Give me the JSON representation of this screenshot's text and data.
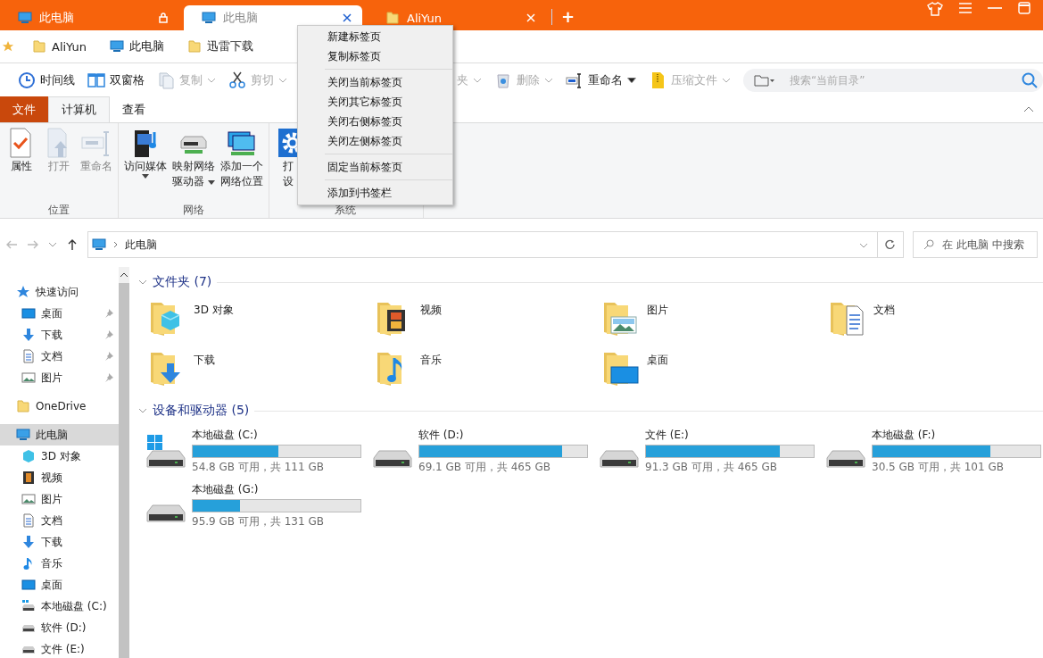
{
  "tabs": [
    {
      "label": "此电脑",
      "selected": false,
      "locked": true,
      "kind": "pc"
    },
    {
      "label": "此电脑",
      "selected": true,
      "locked": false,
      "kind": "pc"
    },
    {
      "label": "AliYun",
      "selected": false,
      "locked": false,
      "kind": "folder"
    }
  ],
  "new_tab": "+",
  "bookmarks": [
    {
      "label": "AliYun",
      "kind": "folder"
    },
    {
      "label": "此电脑",
      "kind": "pc"
    },
    {
      "label": "迅雷下载",
      "kind": "folder"
    }
  ],
  "toolbar": [
    {
      "label": "时间线",
      "kind": "clock",
      "disabled": false,
      "dropdown": false
    },
    {
      "label": "双窗格",
      "kind": "panes",
      "disabled": false,
      "dropdown": false
    },
    {
      "label": "复制",
      "kind": "copy",
      "disabled": true,
      "dropdown": true
    },
    {
      "label": "剪切",
      "kind": "scissors",
      "disabled": true,
      "dropdown": true
    },
    {
      "label": "夹",
      "kind": "text",
      "disabled": true,
      "dropdown": true
    },
    {
      "label": "删除",
      "kind": "trash",
      "disabled": true,
      "dropdown": true
    },
    {
      "label": "重命名",
      "kind": "rename",
      "disabled": false,
      "dropdown": true
    },
    {
      "label": "压缩文件",
      "kind": "zip",
      "disabled": true,
      "dropdown": true
    }
  ],
  "toolbar_search": {
    "placeholder": "搜索“当前目录”"
  },
  "ribbon_tabs": [
    {
      "label": "文件",
      "kind": "file",
      "selected": false
    },
    {
      "label": "计算机",
      "kind": "tab",
      "selected": true
    },
    {
      "label": "查看",
      "kind": "tab",
      "selected": false
    }
  ],
  "ribbon_groups": [
    {
      "label": "位置",
      "buttons": [
        {
          "lines": [
            "属性"
          ],
          "kind": "properties",
          "disabled": false,
          "dropdown": false
        },
        {
          "lines": [
            "打开"
          ],
          "kind": "open",
          "disabled": true,
          "dropdown": false
        },
        {
          "lines": [
            "重命名"
          ],
          "kind": "rename",
          "disabled": true,
          "dropdown": false
        }
      ]
    },
    {
      "label": "网络",
      "buttons": [
        {
          "lines": [
            "访问媒体"
          ],
          "kind": "media",
          "disabled": false,
          "dropdown": true
        },
        {
          "lines": [
            "映射网络",
            "驱动器"
          ],
          "kind": "netdrive",
          "disabled": false,
          "dropdown": true
        },
        {
          "lines": [
            "添加一个",
            "网络位置"
          ],
          "kind": "netloc",
          "disabled": false,
          "dropdown": false
        }
      ]
    },
    {
      "label": "系统",
      "buttons": [
        {
          "lines": [
            "打",
            "设"
          ],
          "kind": "settings",
          "disabled": false,
          "dropdown": false
        }
      ]
    }
  ],
  "context_menu": [
    {
      "label": "新建标签页",
      "kind": "item"
    },
    {
      "label": "复制标签页",
      "kind": "item"
    },
    {
      "kind": "separator"
    },
    {
      "label": "关闭当前标签页",
      "kind": "item"
    },
    {
      "label": "关闭其它标签页",
      "kind": "item"
    },
    {
      "label": "关闭右侧标签页",
      "kind": "item"
    },
    {
      "label": "关闭左侧标签页",
      "kind": "item"
    },
    {
      "kind": "separator"
    },
    {
      "label": "固定当前标签页",
      "kind": "item"
    },
    {
      "kind": "separator"
    },
    {
      "label": "添加到书签栏",
      "kind": "item"
    }
  ],
  "address": {
    "path": "此电脑",
    "search_placeholder": "在 此电脑 中搜索"
  },
  "sidebar": [
    {
      "label": "快速访问",
      "kind": "star",
      "selected": false,
      "pinned": false,
      "children": [
        {
          "label": "桌面",
          "kind": "desktop",
          "selected": false,
          "pinned": true
        },
        {
          "label": "下载",
          "kind": "downloads",
          "selected": false,
          "pinned": true
        },
        {
          "label": "文档",
          "kind": "documents",
          "selected": false,
          "pinned": true
        },
        {
          "label": "图片",
          "kind": "pictures",
          "selected": false,
          "pinned": true
        }
      ]
    },
    {
      "label": "OneDrive",
      "kind": "folder",
      "selected": false,
      "pinned": false
    },
    {
      "label": "此电脑",
      "kind": "pc",
      "selected": true,
      "pinned": false,
      "children": [
        {
          "label": "3D 对象",
          "kind": "objects",
          "selected": false,
          "pinned": false
        },
        {
          "label": "视频",
          "kind": "video",
          "selected": false,
          "pinned": false
        },
        {
          "label": "图片",
          "kind": "pictures",
          "selected": false,
          "pinned": false
        },
        {
          "label": "文档",
          "kind": "documents",
          "selected": false,
          "pinned": false
        },
        {
          "label": "下载",
          "kind": "downloads",
          "selected": false,
          "pinned": false
        },
        {
          "label": "音乐",
          "kind": "music",
          "selected": false,
          "pinned": false
        },
        {
          "label": "桌面",
          "kind": "desktop",
          "selected": false,
          "pinned": false
        },
        {
          "label": "本地磁盘 (C:)",
          "kind": "sysdrive",
          "selected": false,
          "pinned": false
        },
        {
          "label": "软件 (D:)",
          "kind": "drive",
          "selected": false,
          "pinned": false
        },
        {
          "label": "文件 (E:)",
          "kind": "drive",
          "selected": false,
          "pinned": false
        }
      ]
    }
  ],
  "folders_section": {
    "title": "文件夹 (7)",
    "expanded": true,
    "items": [
      {
        "name": "3D 对象",
        "kind": "objects"
      },
      {
        "name": "视频",
        "kind": "video"
      },
      {
        "name": "图片",
        "kind": "pictures"
      },
      {
        "name": "文档",
        "kind": "documents"
      },
      {
        "name": "下载",
        "kind": "downloads"
      },
      {
        "name": "音乐",
        "kind": "music"
      },
      {
        "name": "桌面",
        "kind": "desktop"
      }
    ]
  },
  "drives_section": {
    "title": "设备和驱动器 (5)",
    "expanded": true,
    "items": [
      {
        "name": "本地磁盘 (C:)",
        "system": true,
        "level": 0.51,
        "reading": "54.8 GB 可用，共 111 GB"
      },
      {
        "name": "软件 (D:)",
        "system": false,
        "level": 0.85,
        "reading": "69.1 GB 可用，共 465 GB"
      },
      {
        "name": "文件 (E:)",
        "system": false,
        "level": 0.8,
        "reading": "91.3 GB 可用，共 465 GB"
      },
      {
        "name": "本地磁盘 (F:)",
        "system": false,
        "level": 0.7,
        "reading": "30.5 GB 可用，共 101 GB"
      },
      {
        "name": "本地磁盘 (G:)",
        "system": false,
        "level": 0.28,
        "reading": "95.9 GB 可用，共 131 GB"
      }
    ]
  }
}
